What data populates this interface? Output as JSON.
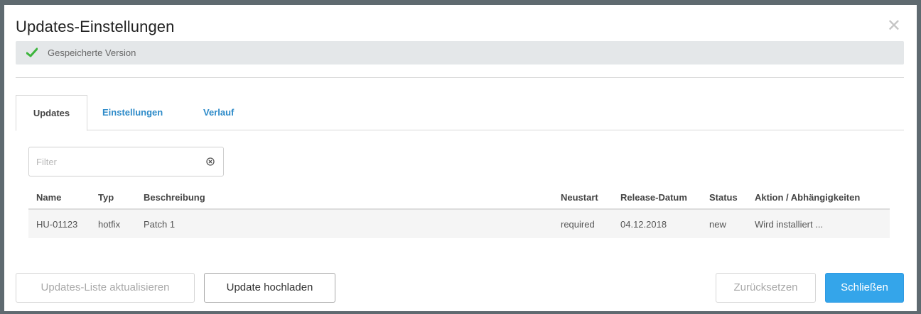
{
  "dialog": {
    "title": "Updates-Einstellungen",
    "close_icon": "close-x-icon",
    "status": {
      "icon": "checkmark-icon",
      "text": "Gespeicherte Version",
      "icon_color": "#3cb53c"
    }
  },
  "tabs": [
    {
      "label": "Updates",
      "active": true
    },
    {
      "label": "Einstellungen",
      "active": false
    },
    {
      "label": "Verlauf",
      "active": false
    }
  ],
  "filter": {
    "placeholder": "Filter",
    "value": "",
    "clear_icon": "clear-circle-icon"
  },
  "table": {
    "headers": [
      "Name",
      "Typ",
      "Beschreibung",
      "Neustart",
      "Release-Datum",
      "Status",
      "Aktion / Abhängigkeiten"
    ],
    "rows": [
      [
        "HU-01123",
        "hotfix",
        "Patch 1",
        "required",
        "04.12.2018",
        "new",
        "Wird installiert ..."
      ]
    ]
  },
  "buttons": {
    "refresh_list": "Updates-Liste aktualisieren",
    "upload_update": "Update hochladen",
    "reset": "Zurücksetzen",
    "close": "Schließen"
  },
  "colors": {
    "accent": "#34a5ea",
    "link": "#2e8bc9",
    "success": "#3cb53c"
  }
}
